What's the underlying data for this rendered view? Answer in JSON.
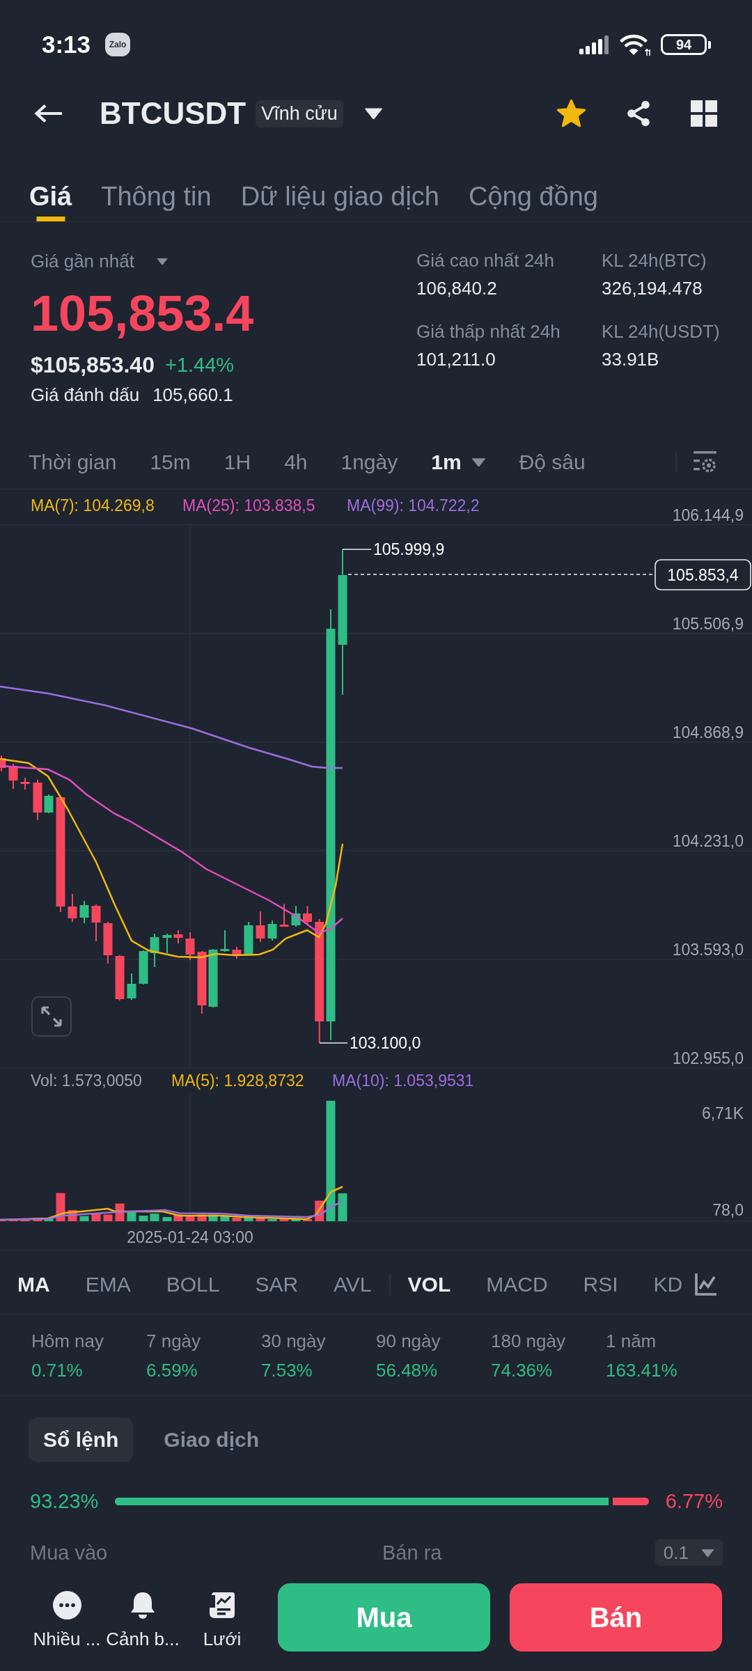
{
  "status_bar": {
    "time": "3:13",
    "app_logo": "Zalo",
    "battery": "94"
  },
  "header": {
    "symbol": "BTCUSDT",
    "contract": "Vĩnh cửu",
    "favorite": true
  },
  "tabs": [
    {
      "label": "Giá",
      "selected": true
    },
    {
      "label": "Thông tin",
      "selected": false
    },
    {
      "label": "Dữ liệu giao dịch",
      "selected": false
    },
    {
      "label": "Cộng đồng",
      "selected": false
    }
  ],
  "price": {
    "label": "Giá gần nhất",
    "last": "105,853.4",
    "rising": false,
    "usd": "$105,853.40",
    "change": "+1.44%",
    "mark_label": "Giá đánh dấu",
    "mark_value": "105,660.1"
  },
  "stats": [
    {
      "label": "Giá cao nhất 24h",
      "value": "106,840.2"
    },
    {
      "label": "KL 24h(BTC)",
      "value": "326,194.478"
    },
    {
      "label": "Giá thấp nhất 24h",
      "value": "101,211.0"
    },
    {
      "label": "KL 24h(USDT)",
      "value": "33.91B"
    }
  ],
  "timeframes": [
    {
      "label": "Thời gian",
      "selected": false,
      "menu": false
    },
    {
      "label": "15m",
      "selected": false,
      "menu": false
    },
    {
      "label": "1H",
      "selected": false,
      "menu": false
    },
    {
      "label": "4h",
      "selected": false,
      "menu": false
    },
    {
      "label": "1ngày",
      "selected": false,
      "menu": false
    },
    {
      "label": "1m",
      "selected": true,
      "menu": true
    },
    {
      "label": "Độ sâu",
      "selected": false,
      "menu": false
    }
  ],
  "chart": {
    "legend": [
      {
        "label": "MA(7): 104.269,8",
        "color": "#f0b90b"
      },
      {
        "label": "MA(25): 103.838,5",
        "color": "#e04fbf"
      },
      {
        "label": "MA(99): 104.722,2",
        "color": "#9b6fdf"
      }
    ],
    "price_axis": [
      "106.144,9",
      "105.506,9",
      "104.868,9",
      "104.231,0",
      "103.593,0",
      "102.955,0"
    ],
    "last_price": "105.853,4",
    "high_label": "105.999,9",
    "low_label": "103.100,0",
    "volume_legend": [
      {
        "label": "Vol: 1.573,0050",
        "color": "#a0a7b2"
      },
      {
        "label": "MA(5): 1.928,8732",
        "color": "#f0b90b"
      },
      {
        "label": "MA(10): 1.053,9531",
        "color": "#9b6fdf"
      }
    ],
    "volume_axis": [
      "6,71K",
      "78,0"
    ],
    "time_axis": [
      "2025-01-24 03:00"
    ]
  },
  "indicators": {
    "main": [
      {
        "label": "MA",
        "selected": true
      },
      {
        "label": "EMA",
        "selected": false
      },
      {
        "label": "BOLL",
        "selected": false
      },
      {
        "label": "SAR",
        "selected": false
      },
      {
        "label": "AVL",
        "selected": false
      }
    ],
    "sub": [
      {
        "label": "VOL",
        "selected": true
      },
      {
        "label": "MACD",
        "selected": false
      },
      {
        "label": "RSI",
        "selected": false
      },
      {
        "label": "KD",
        "selected": false
      }
    ]
  },
  "performance": [
    {
      "label": "Hôm nay",
      "value": "0.71%"
    },
    {
      "label": "7 ngày",
      "value": "6.59%"
    },
    {
      "label": "30 ngày",
      "value": "7.53%"
    },
    {
      "label": "90 ngày",
      "value": "56.48%"
    },
    {
      "label": "180 ngày",
      "value": "74.36%"
    },
    {
      "label": "1 năm",
      "value": "163.41%"
    }
  ],
  "order_book": {
    "tabs": [
      {
        "label": "Sổ lệnh",
        "selected": true
      },
      {
        "label": "Giao dịch",
        "selected": false
      }
    ],
    "buy_share": "93.23%",
    "sell_share": "6.77%",
    "ratio": {
      "level": 0.9323
    },
    "buy_label": "Mua vào",
    "sell_label": "Bán ra",
    "precision": "0.1"
  },
  "bottom_bar": {
    "actions": [
      {
        "kind": "more",
        "label": "Nhiều ..."
      },
      {
        "kind": "alert",
        "label": "Cảnh b..."
      },
      {
        "kind": "grid",
        "label": "Lưới"
      }
    ],
    "buy": "Mua",
    "sell": "Bán"
  }
}
